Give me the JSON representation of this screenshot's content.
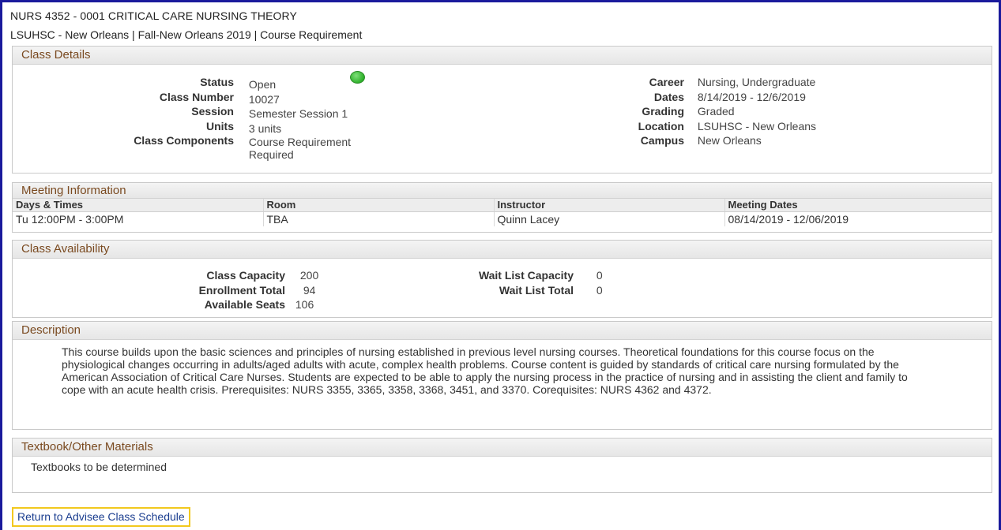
{
  "header": {
    "course_title": "NURS 4352 - 0001   CRITICAL CARE NURSING THEORY",
    "course_subtitle": "LSUHSC - New Orleans | Fall-New Orleans 2019 | Course Requirement"
  },
  "class_details": {
    "heading": "Class Details",
    "left": [
      {
        "label": "Status",
        "value": "Open"
      },
      {
        "label": "Class Number",
        "value": "10027"
      },
      {
        "label": "Session",
        "value": "Semester Session 1"
      },
      {
        "label": "Units",
        "value": "3 units"
      },
      {
        "label": "Class Components",
        "value": "Course Requirement",
        "value2": "Required"
      }
    ],
    "right": [
      {
        "label": "Career",
        "value": "Nursing, Undergraduate"
      },
      {
        "label": "Dates",
        "value": "8/14/2019 - 12/6/2019"
      },
      {
        "label": "Grading",
        "value": "Graded"
      },
      {
        "label": "Location",
        "value": "LSUHSC - New Orleans"
      },
      {
        "label": "Campus",
        "value": "New Orleans"
      }
    ],
    "status_color": "#2eb02a"
  },
  "meeting": {
    "heading": "Meeting Information",
    "columns": [
      "Days & Times",
      "Room",
      "Instructor",
      "Meeting Dates"
    ],
    "rows": [
      [
        "Tu 12:00PM - 3:00PM",
        "TBA",
        "Quinn Lacey",
        "08/14/2019 - 12/06/2019"
      ]
    ]
  },
  "availability": {
    "heading": "Class Availability",
    "left": [
      {
        "label": "Class Capacity",
        "value": "200"
      },
      {
        "label": "Enrollment Total",
        "value": "94"
      },
      {
        "label": "Available Seats",
        "value": "106"
      }
    ],
    "right": [
      {
        "label": "Wait List Capacity",
        "value": "0"
      },
      {
        "label": "Wait List Total",
        "value": "0"
      }
    ]
  },
  "description": {
    "heading": "Description",
    "text": "This course builds upon the basic sciences and principles of nursing established in previous level nursing courses. Theoretical foundations for this course focus on the physiological changes occurring in adults/aged adults with acute, complex health problems. Course content is guided by standards of critical care nursing formulated by the American Association of Critical Care Nurses. Students are expected to be able to apply the nursing process in the practice of nursing and in assisting the client and family to cope with an acute health crisis. Prerequisites: NURS 3355, 3365, 3358, 3368, 3451, and 3370. Corequisites: NURS 4362 and 4372."
  },
  "textbook": {
    "heading": "Textbook/Other Materials",
    "text": "Textbooks to be determined"
  },
  "footer": {
    "return_link": "Return to Advisee Class Schedule"
  }
}
